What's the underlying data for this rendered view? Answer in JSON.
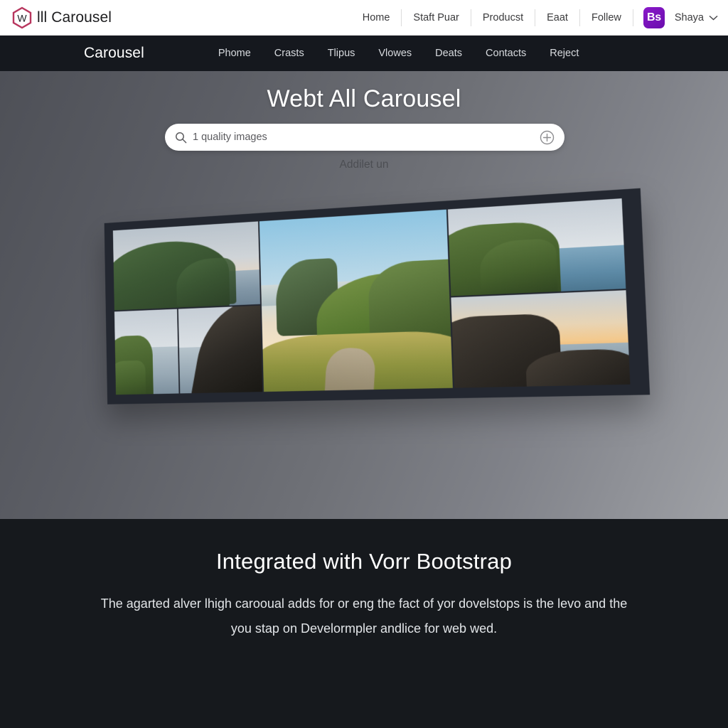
{
  "topbar": {
    "logo_icon": "hexagon-w-logo",
    "logo_letter": "W",
    "brand": "lll Carousel",
    "brand_color": "#b8365e",
    "links": [
      "Home",
      "Staft Puar",
      "Producst",
      "Eaat",
      "Follew"
    ],
    "badge_label": "Bs",
    "badge_color": "#7a12c4",
    "account_name": "Shaya",
    "chevron_icon": "chevron-down-icon"
  },
  "darknav": {
    "brand": "Carousel",
    "links": [
      "Phome",
      "Crasts",
      "Tlipus",
      "Vlowes",
      "Deats",
      "Contacts",
      "Reject"
    ],
    "background": "#15181e"
  },
  "hero": {
    "title": "Webt All Carousel",
    "search": {
      "icon": "search-icon",
      "value": "1 quality images",
      "placeholder": "1 quality images",
      "add_icon": "plus-circle-icon"
    },
    "subtitle": "Addilet un",
    "carousel": {
      "name": "tilted-image-carousel",
      "frame_color": "#232730",
      "tiles": [
        {
          "id": "tile-1",
          "alt": "green headland cliff over ocean at dusk"
        },
        {
          "id": "tile-2",
          "alt": "coastal cliff with clouded sea"
        },
        {
          "id": "tile-3",
          "alt": "dark rocky slope above calm bay"
        },
        {
          "id": "tile-4",
          "alt": "mountain ridge and grassy path at golden hour"
        },
        {
          "id": "tile-5",
          "alt": "green sea cliffs with white surf"
        },
        {
          "id": "tile-6",
          "alt": "rugged rocks at sunset over the sea"
        }
      ]
    }
  },
  "dark_section": {
    "title": "Integrated with Vorr Bootstrap",
    "body": "The agarted alver lhigh carooual adds for or eng the fact of yor dovelstops is the levo and the you stap on Develormpler andlice for web wed.",
    "background": "#16191d"
  }
}
